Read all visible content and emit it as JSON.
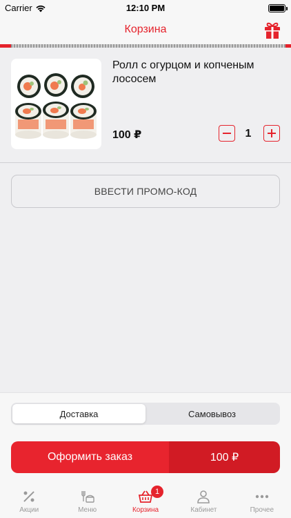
{
  "status_bar": {
    "carrier": "Carrier",
    "time": "12:10 PM"
  },
  "nav": {
    "title": "Корзина",
    "gift_icon": "gift-icon"
  },
  "cart": {
    "items": [
      {
        "name": "Ролл с огурцом и копченым лососем",
        "price": "100 ₽",
        "quantity": "1"
      }
    ]
  },
  "promo": {
    "label": "ВВЕСТИ ПРОМО-КОД"
  },
  "delivery": {
    "options": [
      "Доставка",
      "Самовывоз"
    ],
    "selected": "Доставка"
  },
  "order": {
    "label": "Оформить заказ",
    "total": "100 ₽"
  },
  "tabs": [
    {
      "label": "Акции",
      "icon": "percent-icon"
    },
    {
      "label": "Меню",
      "icon": "menu-food-icon"
    },
    {
      "label": "Корзина",
      "icon": "basket-icon",
      "badge": "1",
      "active": true
    },
    {
      "label": "Кабинет",
      "icon": "person-icon"
    },
    {
      "label": "Прочее",
      "icon": "more-icon"
    }
  ],
  "colors": {
    "accent": "#e5232c",
    "accent_dark": "#d11b24",
    "background": "#efeff1",
    "inactive": "#9a9a9a"
  }
}
